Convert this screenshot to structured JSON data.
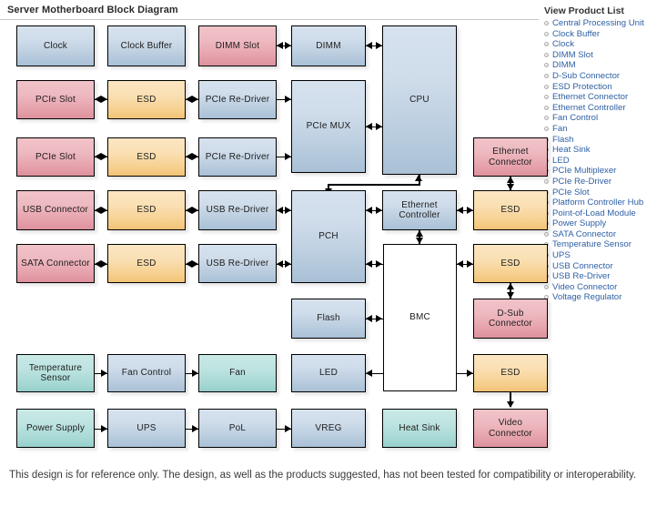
{
  "diagram": {
    "title": "Server Motherboard Block Diagram",
    "blocks": {
      "clock": "Clock",
      "clock_buffer": "Clock Buffer",
      "dimm_slot": "DIMM Slot",
      "dimm": "DIMM",
      "cpu": "CPU",
      "pcie_slot_1": "PCIe Slot",
      "esd_1": "ESD",
      "pcie_redriver_1": "PCIe Re-Driver",
      "pcie_mux": "PCIe MUX",
      "pcie_slot_2": "PCIe Slot",
      "esd_2": "ESD",
      "pcie_redriver_2": "PCIe Re-Driver",
      "ethernet_connector": "Ethernet Connector",
      "usb_connector": "USB Connector",
      "esd_3": "ESD",
      "usb_redriver_1": "USB Re-Driver",
      "pch": "PCH",
      "ethernet_controller": "Ethernet Controller",
      "esd_4": "ESD",
      "sata_connector": "SATA Connector",
      "esd_5": "ESD",
      "usb_redriver_2": "USB Re-Driver",
      "esd_6": "ESD",
      "flash": "Flash",
      "bmc": "BMC",
      "dsub_connector": "D-Sub Connector",
      "temperature_sensor": "Temperature Sensor",
      "fan_control": "Fan Control",
      "fan": "Fan",
      "led": "LED",
      "esd_7": "ESD",
      "power_supply": "Power Supply",
      "ups": "UPS",
      "pol": "PoL",
      "vreg": "VREG",
      "heat_sink": "Heat Sink",
      "video_connector": "Video Connector"
    },
    "colors": {
      "blue": "#bacddf",
      "red": "#e6a2ac",
      "amber": "#f6cf8c",
      "teal": "#a5d8d4",
      "white": "#ffffff",
      "border": "#000000"
    }
  },
  "sidebar": {
    "title": "View Product List",
    "items": [
      "Central Processing Unit",
      "Clock Buffer",
      "Clock",
      "DIMM Slot",
      "DIMM",
      "D-Sub Connector",
      "ESD Protection",
      "Ethernet Connector",
      "Ethernet Controller",
      "Fan Control",
      "Fan",
      "Flash",
      "Heat Sink",
      "LED",
      "PCIe Multiplexer",
      "PCIe Re-Driver",
      "PCIe Slot",
      "Platform Controller Hub",
      "Point-of-Load Module",
      "Power Supply",
      "SATA Connector",
      "Temperature Sensor",
      "UPS",
      "USB Connector",
      "USB Re-Driver",
      "Video Connector",
      "Voltage Regulator"
    ],
    "link_color": "#2d5fa4"
  },
  "footer": {
    "disclaimer": "This design is for reference only. The design, as well as the products suggested, has not been tested for compatibility or interoperability."
  }
}
